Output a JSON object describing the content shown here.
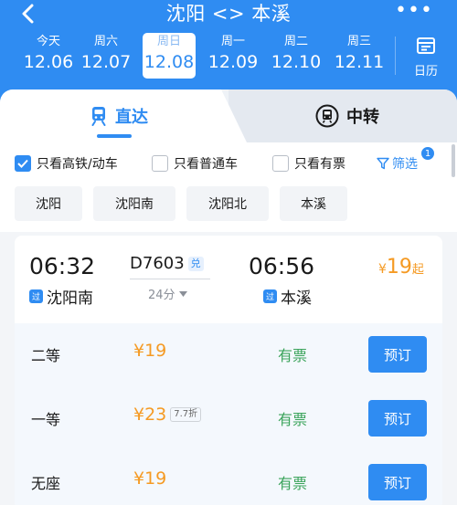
{
  "header": {
    "title": "沈阳 <> 本溪",
    "more": "•••"
  },
  "dates": [
    {
      "weekday": "今天",
      "date": "12.06"
    },
    {
      "weekday": "周六",
      "date": "12.07"
    },
    {
      "weekday": "周日",
      "date": "12.08"
    },
    {
      "weekday": "周一",
      "date": "12.09"
    },
    {
      "weekday": "周二",
      "date": "12.10"
    },
    {
      "weekday": "周三",
      "date": "12.11"
    }
  ],
  "selected_date_index": 2,
  "calendar_label": "日历",
  "tabs": {
    "direct": "直达",
    "transfer": "中转"
  },
  "filters": {
    "hsr_only": {
      "label": "只看高铁/动车",
      "checked": true
    },
    "normal_only": {
      "label": "只看普通车",
      "checked": false
    },
    "available_only": {
      "label": "只看有票",
      "checked": false
    },
    "filter_label": "筛选",
    "filter_count": "1"
  },
  "stations": [
    "沈阳",
    "沈阳南",
    "沈阳北",
    "本溪"
  ],
  "train": {
    "depart_time": "06:32",
    "arrive_time": "06:56",
    "train_no": "D7603",
    "exchange_tag": "兑",
    "duration": "24分",
    "depart_station": "沈阳南",
    "depart_tag": "过",
    "arrive_station": "本溪",
    "arrive_tag": "过",
    "price_symbol": "¥",
    "price": "19",
    "price_suffix": "起"
  },
  "seats": [
    {
      "name": "二等",
      "price": "¥19",
      "discount": "",
      "availability": "有票",
      "button": "预订"
    },
    {
      "name": "一等",
      "price": "¥23",
      "discount": "7.7折",
      "availability": "有票",
      "button": "预订"
    },
    {
      "name": "无座",
      "price": "¥19",
      "discount": "",
      "availability": "有票",
      "button": "预订"
    }
  ],
  "colors": {
    "primary": "#2f8cf2",
    "price": "#f59a23",
    "available": "#3aa35a"
  }
}
